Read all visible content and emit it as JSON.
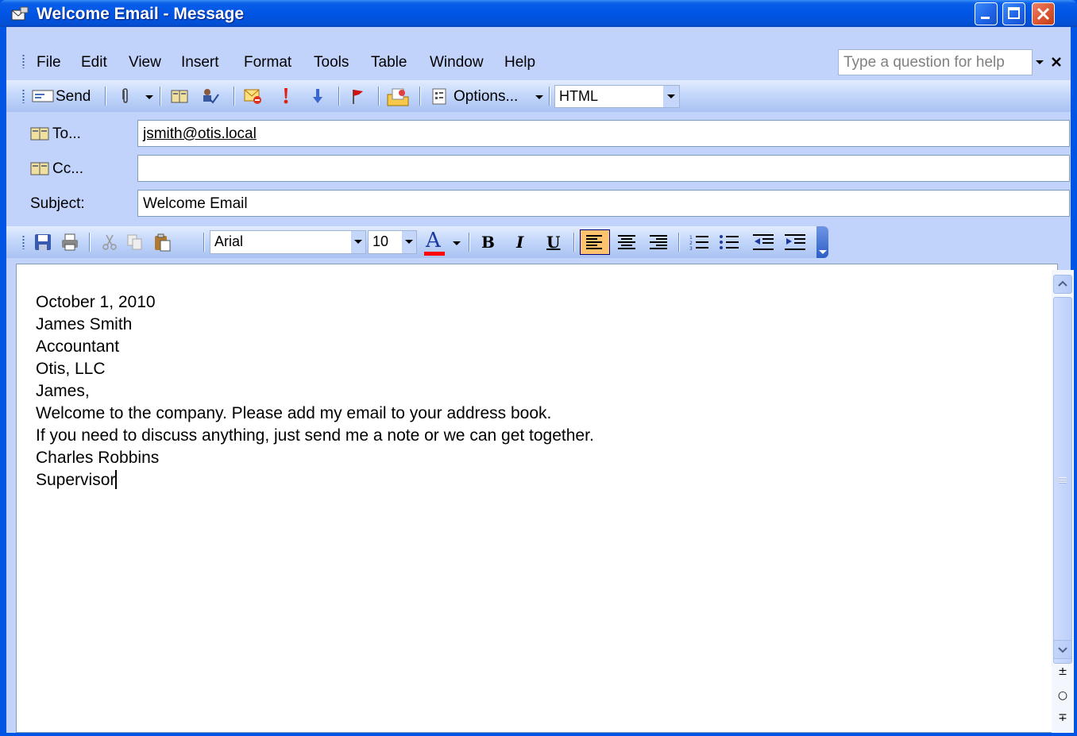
{
  "window": {
    "title": "Welcome Email - Message"
  },
  "menu": {
    "items": [
      "File",
      "Edit",
      "View",
      "Insert",
      "Format",
      "Tools",
      "Table",
      "Window",
      "Help"
    ],
    "help_placeholder": "Type a question for help"
  },
  "toolbar": {
    "send_label": "Send",
    "options_label": "Options...",
    "format_value": "HTML"
  },
  "header": {
    "to_label": "To...",
    "cc_label": "Cc...",
    "subject_label": "Subject:",
    "to_value": "jsmith@otis.local",
    "cc_value": "",
    "subject_value": "Welcome Email"
  },
  "formatting": {
    "font": "Arial",
    "size": "10",
    "bold": "B",
    "italic": "I",
    "underline": "U",
    "font_color_glyph": "A"
  },
  "body": {
    "lines": [
      "October 1, 2010",
      "",
      "James Smith",
      "Accountant",
      "Otis, LLC",
      "",
      "James,",
      "",
      "Welcome to the company. Please add my email to your address book.",
      "",
      "If you need to discuss anything, just send me a note or we can get together.",
      "",
      "Charles Robbins",
      "Supervisor"
    ]
  },
  "colors": {
    "title_bar": "#0055e5",
    "chrome": "#c1d3fb",
    "active_button": "#ffc36e",
    "font_color_bar": "#ff0000"
  }
}
